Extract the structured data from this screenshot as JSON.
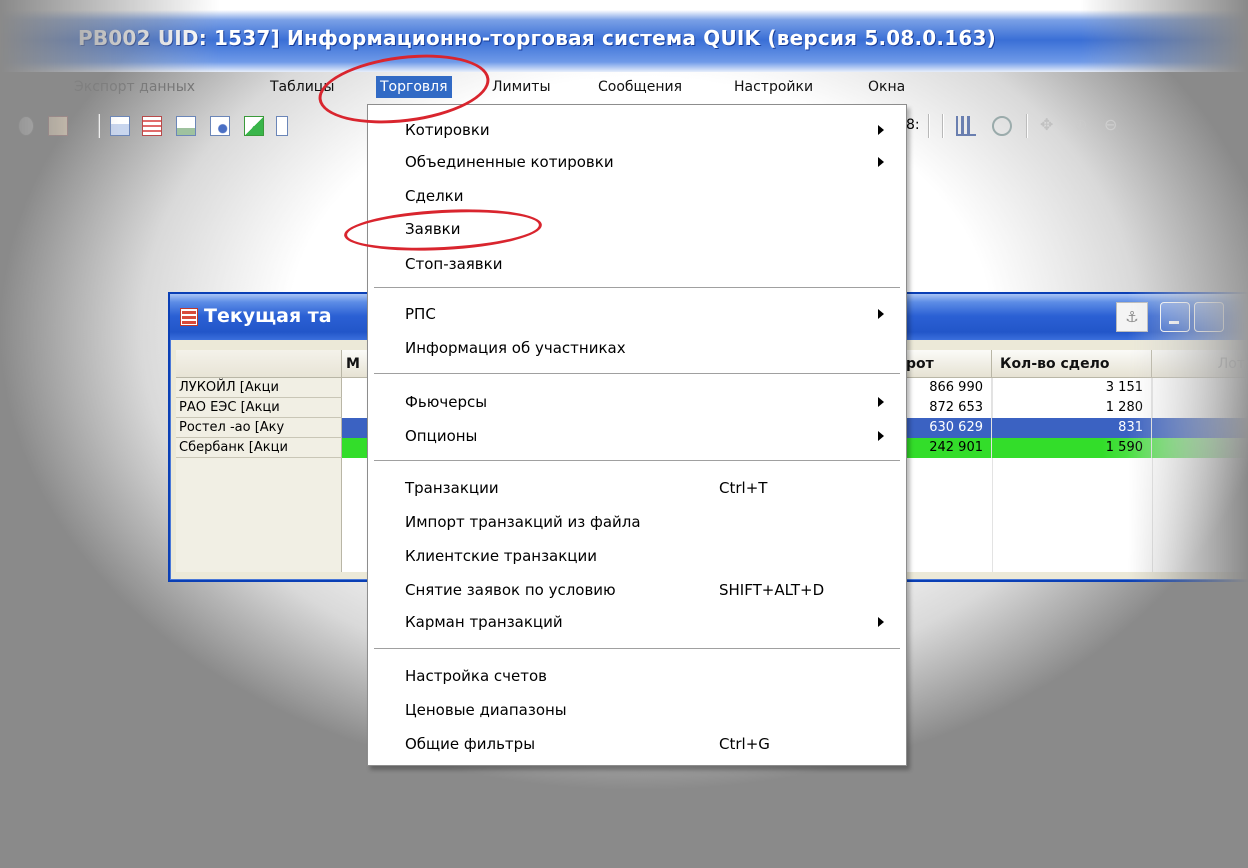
{
  "window": {
    "title": "PB002  UID: 1537] Информационно-торговая система QUIK (версия 5.08.0.163)"
  },
  "menubar": {
    "items": [
      {
        "label": "Экспорт данных"
      },
      {
        "label": "Таблицы"
      },
      {
        "label": "Торговля",
        "active": true
      },
      {
        "label": "Лимиты"
      },
      {
        "label": "Сообщения"
      },
      {
        "label": "Настройки"
      },
      {
        "label": "Окна"
      }
    ]
  },
  "toolbar": {
    "time_fragment": "8:"
  },
  "table_window": {
    "title": "Текущая та",
    "anchor_glyph": "⚓",
    "columns": [
      {
        "label": "М"
      },
      {
        "label": "рот"
      },
      {
        "label": "Кол-во сдело"
      },
      {
        "label": "Лот"
      }
    ],
    "rows": [
      {
        "name": "ЛУКОЙЛ [Акци",
        "turnover": "866 990",
        "deals": "3 151"
      },
      {
        "name": "РАО ЕЭС [Акци",
        "turnover": "872 653",
        "deals": "1 280"
      },
      {
        "name": "Ростел -ао [Аку",
        "turnover": "630 629",
        "deals": "831"
      },
      {
        "name": "Сбербанк [Акци",
        "turnover": "242 901",
        "deals": "1 590"
      }
    ],
    "row_colors": [
      "#ffffff",
      "#ffffff",
      "#3b62c2",
      "#33dd2a"
    ]
  },
  "dropdown": {
    "groups": [
      [
        {
          "label": "Котировки",
          "submenu": true
        },
        {
          "label": "Объединенные котировки",
          "submenu": true
        },
        {
          "label": "Сделки"
        },
        {
          "label": "Заявки",
          "highlighted": true
        },
        {
          "label": "Стоп-заявки"
        }
      ],
      [
        {
          "label": "РПС",
          "submenu": true
        },
        {
          "label": "Информация об участниках"
        }
      ],
      [
        {
          "label": "Фьючерсы",
          "submenu": true
        },
        {
          "label": "Опционы",
          "submenu": true
        }
      ],
      [
        {
          "label": "Транзакции",
          "shortcut": "Ctrl+T"
        },
        {
          "label": "Импорт транзакций из файла"
        },
        {
          "label": "Клиентские транзакции"
        },
        {
          "label": "Снятие заявок по условию",
          "shortcut": "SHIFT+ALT+D"
        },
        {
          "label": "Карман транзакций",
          "submenu": true
        }
      ],
      [
        {
          "label": "Настройка счетов"
        },
        {
          "label": "Ценовые диапазоны"
        },
        {
          "label": "Общие фильтры",
          "shortcut": "Ctrl+G"
        }
      ]
    ]
  },
  "colors": {
    "highlight_ring": "#d9252e",
    "menu_active": "#316ac5",
    "title_blue": "#2256c9"
  }
}
